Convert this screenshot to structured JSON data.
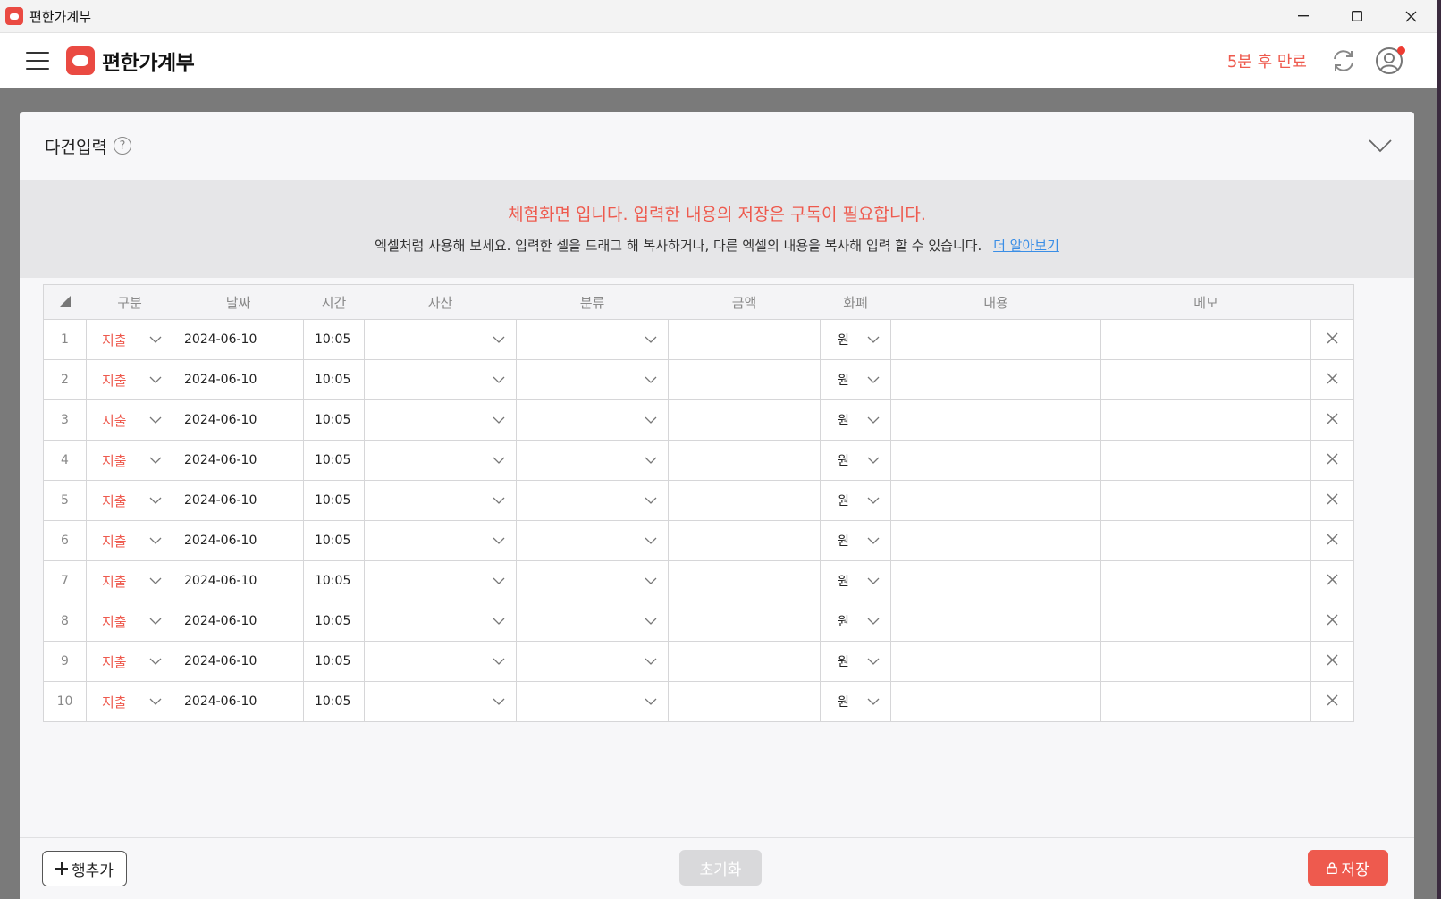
{
  "window": {
    "title": "편한가계부"
  },
  "header": {
    "brand": "편한가계부",
    "expire_text": "5분 후 만료"
  },
  "panel": {
    "title": "다건입력",
    "notice_main": "체험화면 입니다. 입력한 내용의 저장은 구독이 필요합니다.",
    "notice_sub": "엑셀처럼 사용해 보세요. 입력한 셀을 드래그 해 복사하거나, 다른 엑셀의 내용을 복사해 입력 할 수 있습니다.",
    "learn_more": "더 알아보기"
  },
  "grid": {
    "columns": [
      "구분",
      "날짜",
      "시간",
      "자산",
      "분류",
      "금액",
      "화폐",
      "내용",
      "메모"
    ],
    "rows": [
      {
        "num": "1",
        "type": "지출",
        "date": "2024-06-10",
        "time": "10:05",
        "asset": "",
        "category": "",
        "amount": "",
        "currency": "원",
        "content": "",
        "memo": ""
      },
      {
        "num": "2",
        "type": "지출",
        "date": "2024-06-10",
        "time": "10:05",
        "asset": "",
        "category": "",
        "amount": "",
        "currency": "원",
        "content": "",
        "memo": ""
      },
      {
        "num": "3",
        "type": "지출",
        "date": "2024-06-10",
        "time": "10:05",
        "asset": "",
        "category": "",
        "amount": "",
        "currency": "원",
        "content": "",
        "memo": ""
      },
      {
        "num": "4",
        "type": "지출",
        "date": "2024-06-10",
        "time": "10:05",
        "asset": "",
        "category": "",
        "amount": "",
        "currency": "원",
        "content": "",
        "memo": ""
      },
      {
        "num": "5",
        "type": "지출",
        "date": "2024-06-10",
        "time": "10:05",
        "asset": "",
        "category": "",
        "amount": "",
        "currency": "원",
        "content": "",
        "memo": ""
      },
      {
        "num": "6",
        "type": "지출",
        "date": "2024-06-10",
        "time": "10:05",
        "asset": "",
        "category": "",
        "amount": "",
        "currency": "원",
        "content": "",
        "memo": ""
      },
      {
        "num": "7",
        "type": "지출",
        "date": "2024-06-10",
        "time": "10:05",
        "asset": "",
        "category": "",
        "amount": "",
        "currency": "원",
        "content": "",
        "memo": ""
      },
      {
        "num": "8",
        "type": "지출",
        "date": "2024-06-10",
        "time": "10:05",
        "asset": "",
        "category": "",
        "amount": "",
        "currency": "원",
        "content": "",
        "memo": ""
      },
      {
        "num": "9",
        "type": "지출",
        "date": "2024-06-10",
        "time": "10:05",
        "asset": "",
        "category": "",
        "amount": "",
        "currency": "원",
        "content": "",
        "memo": ""
      },
      {
        "num": "10",
        "type": "지출",
        "date": "2024-06-10",
        "time": "10:05",
        "asset": "",
        "category": "",
        "amount": "",
        "currency": "원",
        "content": "",
        "memo": ""
      }
    ]
  },
  "footer": {
    "add_row": "행추가",
    "reset": "초기화",
    "save": "저장"
  },
  "colors": {
    "accent": "#ee5a4e",
    "link": "#3a8ee6"
  }
}
